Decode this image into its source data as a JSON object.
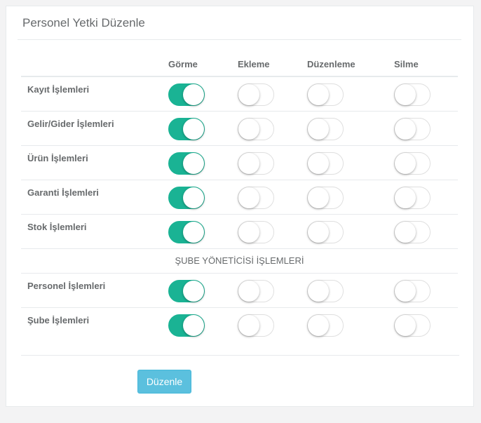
{
  "title": "Personel Yetki Düzenle",
  "columns": [
    "Görme",
    "Ekleme",
    "Düzenleme",
    "Silme"
  ],
  "section_heading": "ŞUBE YÖNETİCİSİ İŞLEMLERİ",
  "rows_top": [
    {
      "label": "Kayıt İşlemleri",
      "toggles": [
        true,
        false,
        false,
        false
      ]
    },
    {
      "label": "Gelir/Gider İşlemleri",
      "toggles": [
        true,
        false,
        false,
        false
      ]
    },
    {
      "label": "Ürün İşlemleri",
      "toggles": [
        true,
        false,
        false,
        false
      ]
    },
    {
      "label": "Garanti İşlemleri",
      "toggles": [
        true,
        false,
        false,
        false
      ]
    },
    {
      "label": "Stok İşlemleri",
      "toggles": [
        true,
        false,
        false,
        false
      ]
    }
  ],
  "rows_bottom": [
    {
      "label": "Personel İşlemleri",
      "toggles": [
        true,
        false,
        false,
        false
      ]
    },
    {
      "label": "Şube İşlemleri",
      "toggles": [
        true,
        false,
        false,
        false
      ]
    }
  ],
  "submit_label": "Düzenle",
  "colors": {
    "toggle_on": "#1ab394",
    "button": "#5bc0de",
    "text": "#676a6c"
  }
}
